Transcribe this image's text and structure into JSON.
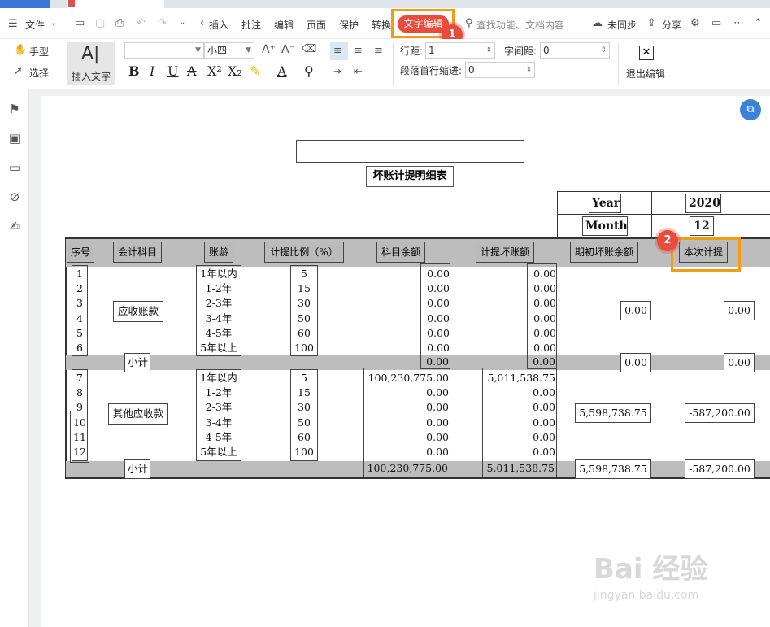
{
  "menu": {
    "file": "文件",
    "insert": "插入",
    "review": "批注",
    "edit": "编辑",
    "page": "页面",
    "protect": "保护",
    "convert": "转换",
    "active_tab": "文字编辑",
    "search_placeholder": "查找功能、文档内容",
    "sync": "未同步",
    "share": "分享"
  },
  "annotations": {
    "badge1": "1",
    "badge2": "2"
  },
  "toolbar": {
    "hand": "手型",
    "select": "选择",
    "insert_text": "插入文字",
    "font_size": "小四",
    "line_spacing_label": "行距:",
    "line_spacing_value": "1",
    "char_spacing_label": "字间距:",
    "char_spacing_value": "0",
    "indent_label": "段落首行缩进:",
    "indent_value": "0",
    "exit_edit": "退出编辑"
  },
  "doc": {
    "title": "坏账计提明细表",
    "year_label": "Year",
    "year_value": "2020",
    "month_label": "Month",
    "month_value": "12",
    "headers": [
      "序号",
      "会计科目",
      "账龄",
      "计提比例（%）",
      "科目余额",
      "计提坏账额",
      "期初坏账余额",
      "本次计提"
    ],
    "section1": {
      "account": "应收账款",
      "seq": [
        "1",
        "2",
        "3",
        "4",
        "5",
        "6"
      ],
      "ages": [
        "1年以内",
        "1-2年",
        "2-3年",
        "3-4年",
        "4-5年",
        "5年以上"
      ],
      "rates": [
        "5",
        "15",
        "30",
        "50",
        "60",
        "100"
      ],
      "balances": [
        "0.00",
        "0.00",
        "0.00",
        "0.00",
        "0.00",
        "0.00"
      ],
      "provisions": [
        "0.00",
        "0.00",
        "0.00",
        "0.00",
        "0.00",
        "0.00"
      ],
      "opening": "0.00",
      "current": "0.00",
      "subtotal_label": "小计",
      "subtotal_balance": "0.00",
      "subtotal_provision": "0.00",
      "subtotal_opening": "0.00",
      "subtotal_current": "0.00"
    },
    "section2": {
      "account": "其他应收款",
      "seq": [
        "7",
        "8",
        "9",
        "10",
        "11",
        "12"
      ],
      "ages": [
        "1年以内",
        "1-2年",
        "2-3年",
        "3-4年",
        "4-5年",
        "5年以上"
      ],
      "rates": [
        "5",
        "15",
        "30",
        "50",
        "60",
        "100"
      ],
      "balances": [
        "100,230,775.00",
        "0.00",
        "0.00",
        "0.00",
        "0.00",
        "0.00"
      ],
      "provisions": [
        "5,011,538.75",
        "0.00",
        "0.00",
        "0.00",
        "0.00",
        "0.00"
      ],
      "opening": "5,598,738.75",
      "current": "-587,200.00",
      "subtotal_label": "小计",
      "subtotal_balance": "100,230,775.00",
      "subtotal_provision": "5,011,538.75",
      "subtotal_opening": "5,598,738.75",
      "subtotal_current": "-587,200.00"
    }
  },
  "watermark": {
    "brand": "Bai 经验",
    "url": "jingyan.baidu.com"
  },
  "colors": {
    "accent_red": "#e74c3c",
    "highlight_orange": "#f39c12",
    "float_blue": "#3b82d6"
  }
}
